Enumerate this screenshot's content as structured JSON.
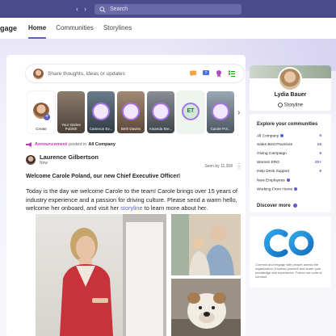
{
  "titlebar": {
    "nav_back": "‹",
    "nav_forward": "›",
    "search_placeholder": "Search"
  },
  "appbar": {
    "app_name": "gage",
    "tabs": [
      {
        "label": "Home",
        "active": true
      },
      {
        "label": "Communities",
        "active": false
      },
      {
        "label": "Storylines",
        "active": false
      }
    ]
  },
  "composer": {
    "placeholder": "Share thoughts, ideas or updates",
    "icons": [
      "chat-icon",
      "question-icon",
      "praise-icon",
      "list-icon"
    ]
  },
  "stories": {
    "create_label": "Create",
    "items": [
      {
        "name": "Your stories",
        "sub": "Publish"
      },
      {
        "name": "Cameron Ev...",
        "sub": ""
      },
      {
        "name": "Beth Davies",
        "sub": ""
      },
      {
        "name": "Amanda Bre...",
        "sub": ""
      },
      {
        "name": "ET",
        "sub": ""
      },
      {
        "name": "Carole Pol...",
        "sub": ""
      }
    ]
  },
  "post": {
    "announcement_label": "Announcement",
    "posted_in": "posted in",
    "community": "All Company",
    "author": "Laurence Gilbertson",
    "time": "Now",
    "seen_by": "Seen by 11,358",
    "title": "Welcome Carole Poland, our new Chief Executive Officer!",
    "body_1": "Today is the day we welcome Carole to the team! Carole brings over 15 years of industry experience and a passion for driving culture. Please send a warm hello, welcome her onboard, and visit her ",
    "body_link": "storyline",
    "body_2": " to learn more about her."
  },
  "profile": {
    "name": "Lydia Bauer",
    "storyline_label": "Storyline"
  },
  "communities": {
    "heading": "Explore your communities",
    "items": [
      {
        "name": "All Company",
        "count": "6",
        "dot": true
      },
      {
        "name": "Sales Best Practices",
        "count": "16",
        "dot": false
      },
      {
        "name": "Giving Campaign",
        "count": "9",
        "dot": false
      },
      {
        "name": "Women ERG",
        "count": "20+",
        "dot": false
      },
      {
        "name": "Help Desk Support",
        "count": "6",
        "dot": false
      },
      {
        "name": "New Employees",
        "count": "",
        "dot": true
      },
      {
        "name": "Working From Home",
        "count": "",
        "dot": true
      }
    ],
    "discover_label": "Discover more"
  },
  "viva": {
    "blurb": "Connect and engage with people across the organization. Express yourself and share your knowledge and experience. Follow our code of conduct."
  },
  "colors": {
    "brand": "#5b5fc7",
    "titlebar": "#4b4a8a",
    "announcement": "#c239b3"
  }
}
